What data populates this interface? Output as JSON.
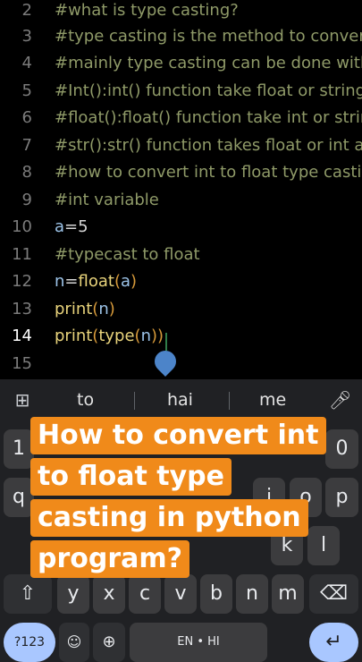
{
  "editor": {
    "lines": [
      {
        "num": "2",
        "text": "#what is type casting?",
        "kind": "comment"
      },
      {
        "num": "3",
        "text": "#type casting is the method to convert",
        "kind": "comment"
      },
      {
        "num": "4",
        "text": "#mainly type casting can be done with",
        "kind": "comment"
      },
      {
        "num": "5",
        "text": "#Int():int() function take float or string",
        "kind": "comment"
      },
      {
        "num": "6",
        "text": "#float():float() function take int or string",
        "kind": "comment"
      },
      {
        "num": "7",
        "text": "#str():str() function takes float or int as",
        "kind": "comment"
      },
      {
        "num": "8",
        "text": "#how to convert int to float type casting",
        "kind": "comment"
      },
      {
        "num": "9",
        "text": "#int variable",
        "kind": "comment"
      },
      {
        "num": "10",
        "var": "a",
        "op": "=",
        "val": "5",
        "kind": "assign"
      },
      {
        "num": "11",
        "text": "#typecast to float",
        "kind": "comment"
      },
      {
        "num": "12",
        "var": "n",
        "op": "=",
        "fn": "float",
        "arg": "a",
        "kind": "call_assign"
      },
      {
        "num": "13",
        "fn": "print",
        "arg": "n",
        "kind": "call"
      },
      {
        "num": "14",
        "fn": "print",
        "inner_fn": "type",
        "arg": "n",
        "kind": "nested_call",
        "active": true
      },
      {
        "num": "15",
        "text": "",
        "kind": "empty"
      }
    ]
  },
  "keyboard": {
    "suggestions": [
      "to",
      "hai",
      "me"
    ],
    "row_numbers": [
      "1",
      "0"
    ],
    "row_q": [
      "q",
      "i",
      "o",
      "p"
    ],
    "row_a": [
      "k",
      "l"
    ],
    "row_z": [
      "y",
      "x",
      "c",
      "v",
      "b",
      "n",
      "m"
    ],
    "bottom": {
      "symbols": "?123",
      "emoji": "☺",
      "globe": "⊕",
      "space": "EN • HI"
    }
  },
  "overlay": {
    "title_lines": [
      "How to convert int",
      "to float type",
      "casting in python",
      "program?"
    ]
  },
  "colors": {
    "editor_bg": "#000000",
    "comment": "#8f9a68",
    "variable": "#9cc3e8",
    "function": "#e8d37b",
    "paren": "#d79a3a",
    "overlay_bg": "#f08a1a",
    "keyboard_bg": "#202124",
    "key_bg": "#3c3c3e"
  },
  "icons": [
    "grid-icon",
    "mic-icon",
    "shift-icon",
    "backspace-icon",
    "emoji-icon",
    "globe-icon",
    "enter-icon",
    "cursor-drop-icon"
  ]
}
